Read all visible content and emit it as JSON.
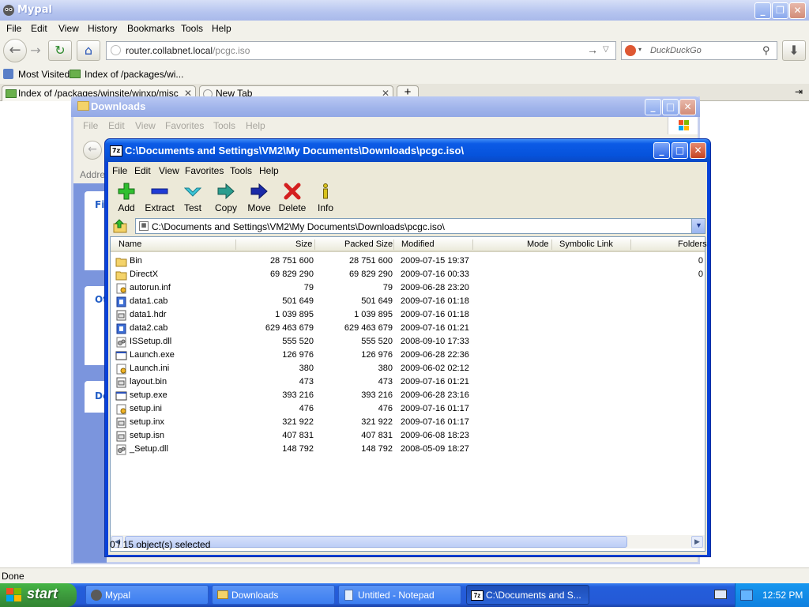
{
  "browser": {
    "title": "Mypal",
    "menu": [
      "File",
      "Edit",
      "View",
      "History",
      "Bookmarks",
      "Tools",
      "Help"
    ],
    "url_host": "router.collabnet.local",
    "url_path": "/pcgc.iso",
    "search_placeholder": "DuckDuckGo",
    "bookmarks": [
      "Most Visited",
      "Index of /packages/wi..."
    ],
    "tabs": [
      "Index of /packages/winsite/winxp/misc",
      "New Tab"
    ],
    "status": "Done"
  },
  "explorer": {
    "title": "Downloads",
    "menu": [
      "File",
      "Edit",
      "View",
      "Favorites",
      "Tools",
      "Help"
    ],
    "address_label": "Addres",
    "side_labels": [
      "Fil",
      "Ot",
      "De"
    ]
  },
  "zip": {
    "title": "C:\\Documents and Settings\\VM2\\My Documents\\Downloads\\pcgc.iso\\",
    "menu": [
      "File",
      "Edit",
      "View",
      "Favorites",
      "Tools",
      "Help"
    ],
    "toolbar": [
      "Add",
      "Extract",
      "Test",
      "Copy",
      "Move",
      "Delete",
      "Info"
    ],
    "address": "C:\\Documents and Settings\\VM2\\My Documents\\Downloads\\pcgc.iso\\",
    "columns": [
      "Name",
      "Size",
      "Packed Size",
      "Modified",
      "Mode",
      "Symbolic Link",
      "Folders"
    ],
    "files": [
      {
        "name": "Bin",
        "size": "28 751 600",
        "packed": "28 751 600",
        "modified": "2009-07-15 19:37",
        "folders": "0",
        "icon": "folder-icon"
      },
      {
        "name": "DirectX",
        "size": "69 829 290",
        "packed": "69 829 290",
        "modified": "2009-07-16 00:33",
        "folders": "0",
        "icon": "folder-icon"
      },
      {
        "name": "autorun.inf",
        "size": "79",
        "packed": "79",
        "modified": "2009-06-28 23:20",
        "folders": "",
        "icon": "settings-file-icon"
      },
      {
        "name": "data1.cab",
        "size": "501 649",
        "packed": "501 649",
        "modified": "2009-07-16 01:18",
        "folders": "",
        "icon": "cab-file-icon"
      },
      {
        "name": "data1.hdr",
        "size": "1 039 895",
        "packed": "1 039 895",
        "modified": "2009-07-16 01:18",
        "folders": "",
        "icon": "generic-file-icon"
      },
      {
        "name": "data2.cab",
        "size": "629 463 679",
        "packed": "629 463 679",
        "modified": "2009-07-16 01:21",
        "folders": "",
        "icon": "cab-file-icon"
      },
      {
        "name": "ISSetup.dll",
        "size": "555 520",
        "packed": "555 520",
        "modified": "2008-09-10 17:33",
        "folders": "",
        "icon": "dll-file-icon"
      },
      {
        "name": "Launch.exe",
        "size": "126 976",
        "packed": "126 976",
        "modified": "2009-06-28 22:36",
        "folders": "",
        "icon": "exe-file-icon"
      },
      {
        "name": "Launch.ini",
        "size": "380",
        "packed": "380",
        "modified": "2009-06-02 02:12",
        "folders": "",
        "icon": "settings-file-icon"
      },
      {
        "name": "layout.bin",
        "size": "473",
        "packed": "473",
        "modified": "2009-07-16 01:21",
        "folders": "",
        "icon": "generic-file-icon"
      },
      {
        "name": "setup.exe",
        "size": "393 216",
        "packed": "393 216",
        "modified": "2009-06-28 23:16",
        "folders": "",
        "icon": "exe-file-icon"
      },
      {
        "name": "setup.ini",
        "size": "476",
        "packed": "476",
        "modified": "2009-07-16 01:17",
        "folders": "",
        "icon": "settings-file-icon"
      },
      {
        "name": "setup.inx",
        "size": "321 922",
        "packed": "321 922",
        "modified": "2009-07-16 01:17",
        "folders": "",
        "icon": "generic-file-icon"
      },
      {
        "name": "setup.isn",
        "size": "407 831",
        "packed": "407 831",
        "modified": "2009-06-08 18:23",
        "folders": "",
        "icon": "generic-file-icon"
      },
      {
        "name": "_Setup.dll",
        "size": "148 792",
        "packed": "148 792",
        "modified": "2008-05-09 18:27",
        "folders": "",
        "icon": "dll-file-icon"
      }
    ],
    "status": "0 / 15 object(s) selected"
  },
  "taskbar": {
    "start": "start",
    "items": [
      "Mypal",
      "Downloads",
      "Untitled - Notepad",
      "C:\\Documents and S..."
    ],
    "clock": "12:52 PM"
  },
  "colors": {
    "xp_blue": "#0842d8",
    "start_green": "#3d9a3d",
    "window_face": "#ece9d8"
  }
}
